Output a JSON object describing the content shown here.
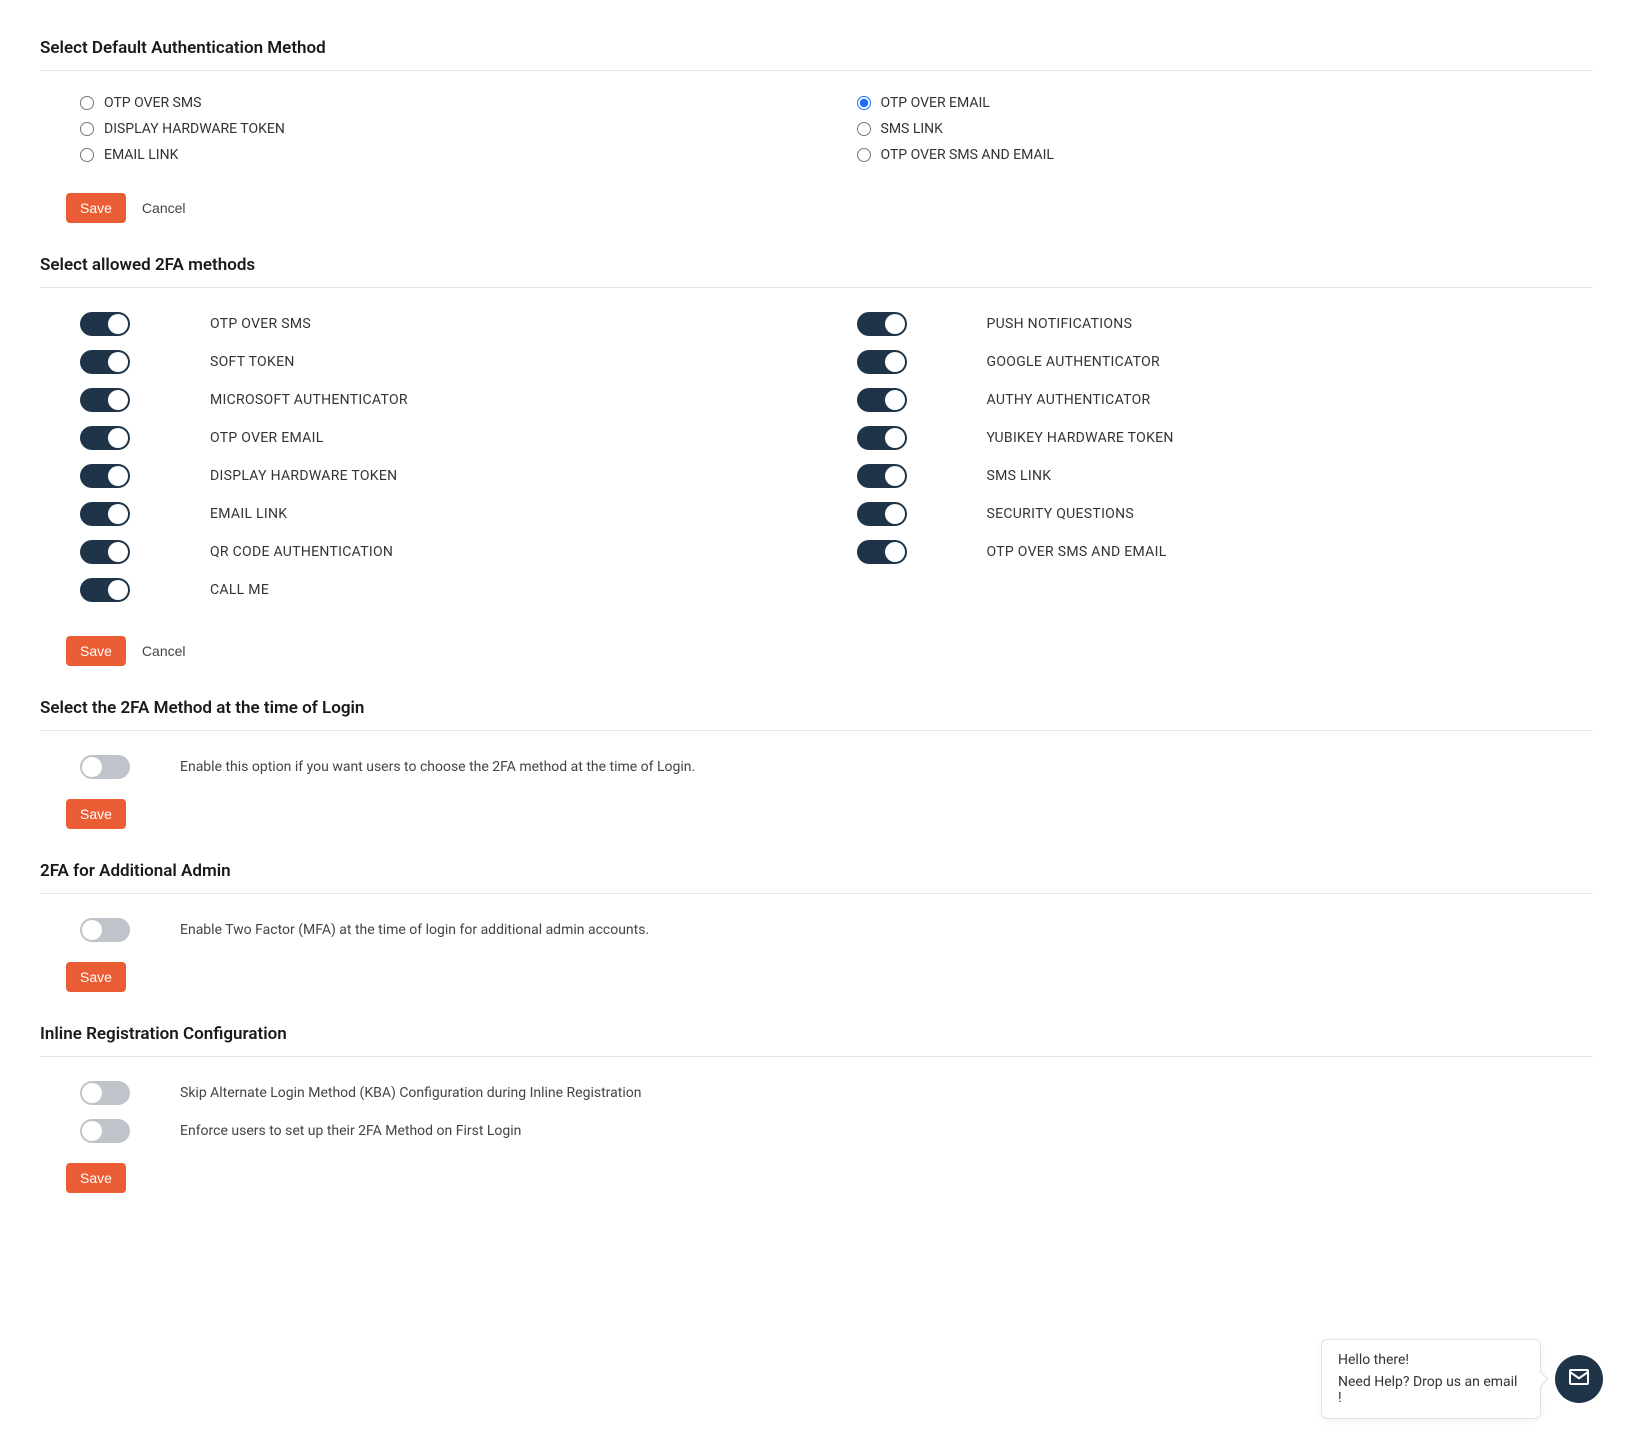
{
  "sections": {
    "defaultAuth": {
      "title": "Select Default Authentication Method",
      "options": {
        "left": [
          {
            "label": "OTP OVER SMS",
            "selected": false
          },
          {
            "label": "DISPLAY HARDWARE TOKEN",
            "selected": false
          },
          {
            "label": "EMAIL LINK",
            "selected": false
          }
        ],
        "right": [
          {
            "label": "OTP OVER EMAIL",
            "selected": true
          },
          {
            "label": "SMS LINK",
            "selected": false
          },
          {
            "label": "OTP OVER SMS AND EMAIL",
            "selected": false
          }
        ]
      },
      "saveLabel": "Save",
      "cancelLabel": "Cancel"
    },
    "allowed2fa": {
      "title": "Select allowed 2FA methods",
      "left": [
        {
          "label": "OTP OVER SMS",
          "on": true
        },
        {
          "label": "SOFT TOKEN",
          "on": true
        },
        {
          "label": "MICROSOFT AUTHENTICATOR",
          "on": true
        },
        {
          "label": "OTP OVER EMAIL",
          "on": true
        },
        {
          "label": "DISPLAY HARDWARE TOKEN",
          "on": true
        },
        {
          "label": "EMAIL LINK",
          "on": true
        },
        {
          "label": "QR CODE AUTHENTICATION",
          "on": true
        },
        {
          "label": "CALL ME",
          "on": true
        }
      ],
      "right": [
        {
          "label": "PUSH NOTIFICATIONS",
          "on": true
        },
        {
          "label": "GOOGLE AUTHENTICATOR",
          "on": true
        },
        {
          "label": "AUTHY AUTHENTICATOR",
          "on": true
        },
        {
          "label": "YUBIKEY HARDWARE TOKEN",
          "on": true
        },
        {
          "label": "SMS LINK",
          "on": true
        },
        {
          "label": "SECURITY QUESTIONS",
          "on": true
        },
        {
          "label": "OTP OVER SMS AND EMAIL",
          "on": true
        }
      ],
      "saveLabel": "Save",
      "cancelLabel": "Cancel"
    },
    "loginTime": {
      "title": "Select the 2FA Method at the time of Login",
      "desc": "Enable this option if you want users to choose the 2FA method at the time of Login.",
      "on": false,
      "saveLabel": "Save"
    },
    "additionalAdmin": {
      "title": "2FA for Additional Admin",
      "desc": "Enable Two Factor (MFA) at the time of login for additional admin accounts.",
      "on": false,
      "saveLabel": "Save"
    },
    "inlineReg": {
      "title": "Inline Registration Configuration",
      "rows": [
        {
          "label": "Skip Alternate Login Method (KBA) Configuration during Inline Registration",
          "on": false
        },
        {
          "label": "Enforce users to set up their 2FA Method on First Login",
          "on": false
        }
      ],
      "saveLabel": "Save"
    }
  },
  "chat": {
    "line1": "Hello there!",
    "line2": "Need Help? Drop us an email !"
  }
}
